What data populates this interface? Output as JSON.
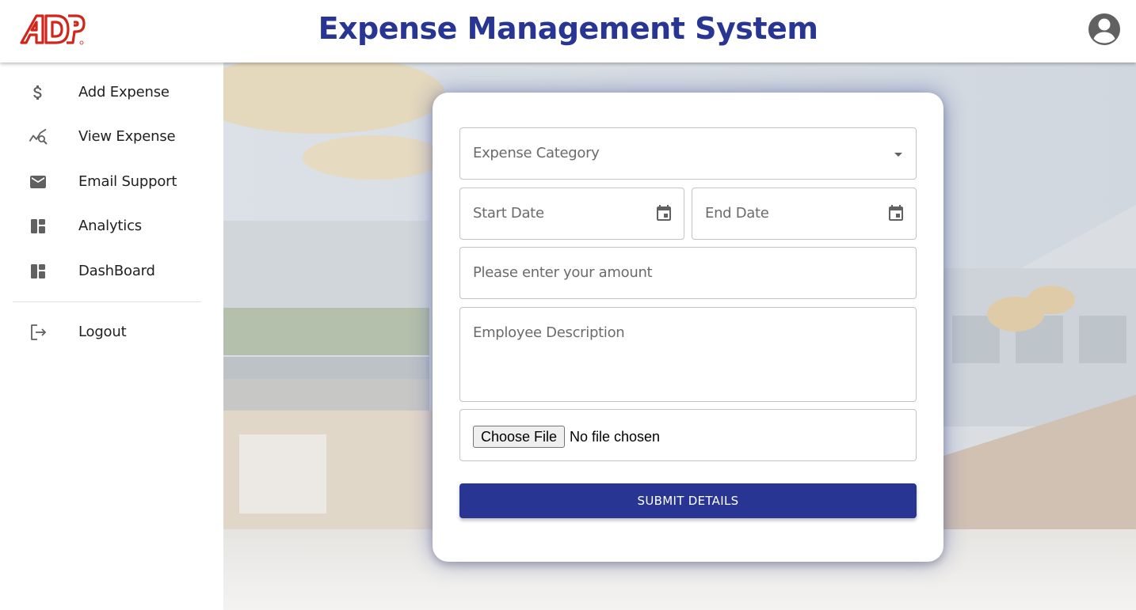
{
  "header": {
    "logo_text": "ADP",
    "title": "Expense Management System",
    "account_icon": "account-circle-icon"
  },
  "sidebar": {
    "items": [
      {
        "label": "Add Expense",
        "icon": "dollar-icon"
      },
      {
        "label": "View Expense",
        "icon": "query-stats-icon"
      },
      {
        "label": "Email Support",
        "icon": "mail-icon"
      },
      {
        "label": "Analytics",
        "icon": "dashboard-icon"
      },
      {
        "label": "DashBoard",
        "icon": "dashboard-icon"
      }
    ],
    "logout": {
      "label": "Logout",
      "icon": "logout-icon"
    }
  },
  "form": {
    "category_placeholder": "Expense Category",
    "start_date_placeholder": "Start Date",
    "end_date_placeholder": "End Date",
    "amount_placeholder": "Please enter your amount",
    "description_placeholder": "Employee Description",
    "file_button_label": "Choose File",
    "file_status": "No file chosen",
    "submit_label": "SUBMIT DETAILS"
  },
  "colors": {
    "brand_primary": "#283593",
    "logo_red": "#d0271d"
  }
}
